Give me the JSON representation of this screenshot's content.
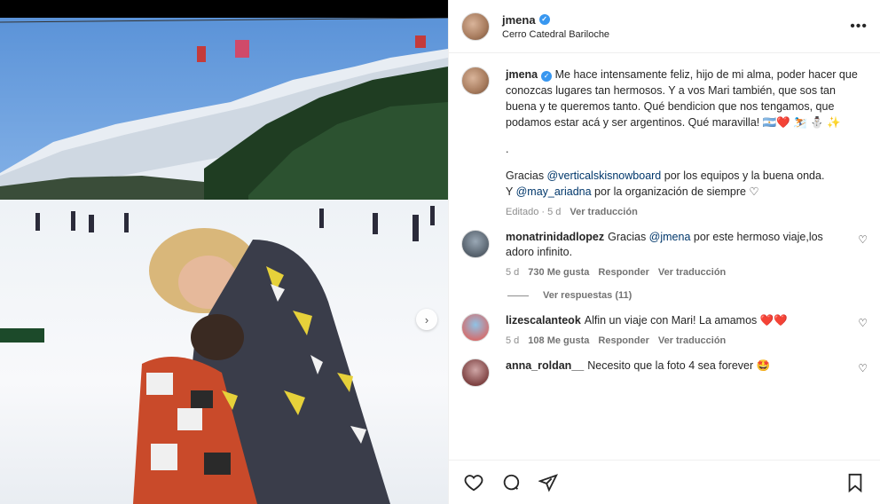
{
  "post": {
    "username": "jmena",
    "location": "Cerro Catedral Bariloche",
    "caption": "Me hace intensamente feliz, hijo de mi alma, poder hacer que conozcas lugares tan hermosos. Y a vos Mari también, que sos tan buena y te queremos tanto. Qué bendicion que nos tengamos, que podamos estar acá y ser argentinos. Qué maravilla! 🇦🇷❤️ ⛷️ ⛄ ✨",
    "dot": ".",
    "thanks_prefix": "Gracias ",
    "thanks_mention": "@verticalskisnowboard",
    "thanks_suffix": " por los equipos y la buena onda.",
    "org_prefix": "Y ",
    "org_mention": "@may_ariadna",
    "org_suffix": " por la organización de siempre ♡",
    "edited": "Editado · 5 d",
    "see_translation": "Ver traducción"
  },
  "comments": [
    {
      "username": "monatrinidadlopez",
      "text_prefix": "Gracias ",
      "mention": "@jmena",
      "text_suffix": " por este hermoso viaje,los adoro infinito.",
      "age": "5 d",
      "likes": "730 Me gusta",
      "reply": "Responder",
      "translate": "Ver traducción",
      "view_replies": "Ver respuestas (11)"
    },
    {
      "username": "lizescalanteok",
      "text": "Alfin un viaje con Mari! La amamos ❤️❤️",
      "age": "5 d",
      "likes": "108 Me gusta",
      "reply": "Responder",
      "translate": "Ver traducción"
    },
    {
      "username": "anna_roldan__",
      "text": "Necesito que la foto 4 sea forever 🤩"
    }
  ],
  "icons": [
    "heart-icon",
    "comment-icon",
    "share-icon",
    "save-icon",
    "more-icon",
    "verified-icon",
    "next-arrow-icon"
  ],
  "colors": {
    "link": "#00376b",
    "verified": "#3897f0",
    "muted": "#8e8e8e"
  }
}
